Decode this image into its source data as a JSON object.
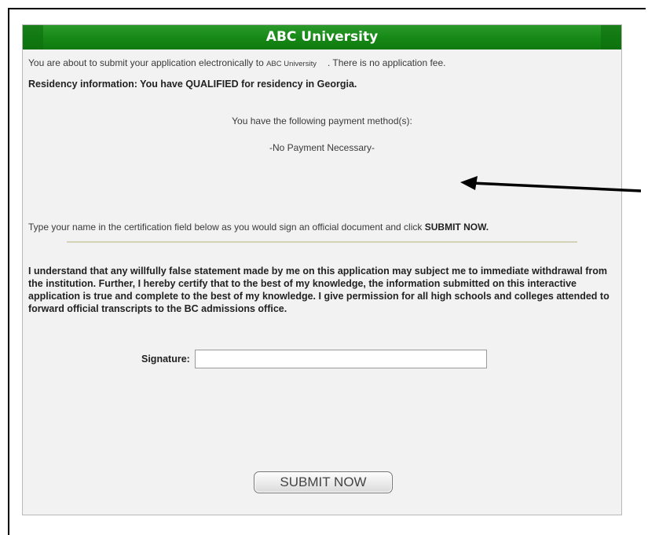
{
  "header": {
    "title": "ABC University"
  },
  "intro": {
    "text_before": "You are about to submit your application electronically to ",
    "university": "ABC University",
    "text_after": ". There is no application fee."
  },
  "residency": "Residency information: You have QUALIFIED for residency in Georgia.",
  "payment": {
    "heading": "You have the following payment method(s):",
    "method": "-No Payment Necessary-"
  },
  "certification": {
    "instruction": "Type your name in the certification field below as you would sign an official document and click ",
    "instruction_bold": "SUBMIT NOW."
  },
  "legal_text": "I understand that any willfully false statement made by me on this application may subject me to immediate withdrawal from the institution. Further, I hereby certify that to the best of my knowledge, the information submitted on this interactive application is true and complete to the best of my knowledge. I give permission for all high schools and colleges attended to forward official transcripts to the BC admissions office.",
  "signature": {
    "label": "Signature:",
    "value": ""
  },
  "submit_label": "SUBMIT NOW",
  "colors": {
    "header_green": "#168816",
    "panel_bg": "#f2f2f2"
  }
}
